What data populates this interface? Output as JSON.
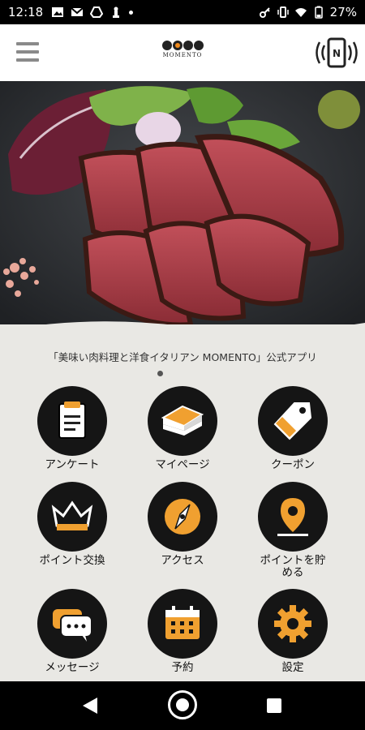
{
  "status_bar": {
    "time": "12:18",
    "battery": "27%"
  },
  "header": {
    "logo_text": "MOMENTO",
    "logo_subtext": "美味い肉料理と洋食イタリアン"
  },
  "hero": {
    "tagline": "「美味い肉料理と洋食イタリアン MOMENTO」公式アプリ"
  },
  "menu": [
    {
      "label": "アンケート",
      "icon": "survey-icon"
    },
    {
      "label": "マイページ",
      "icon": "book-icon"
    },
    {
      "label": "クーポン",
      "icon": "coupon-tag-icon"
    },
    {
      "label": "ポイント交換",
      "icon": "crown-icon"
    },
    {
      "label": "アクセス",
      "icon": "compass-icon"
    },
    {
      "label": "ポイントを貯\nめる",
      "icon": "map-pin-icon"
    },
    {
      "label": "メッセージ",
      "icon": "chat-icon"
    },
    {
      "label": "予約",
      "icon": "calendar-icon"
    },
    {
      "label": "設定",
      "icon": "gear-icon"
    }
  ],
  "colors": {
    "accent": "#f0a030",
    "tile_bg": "#151515",
    "content_bg": "#e9e8e4"
  }
}
